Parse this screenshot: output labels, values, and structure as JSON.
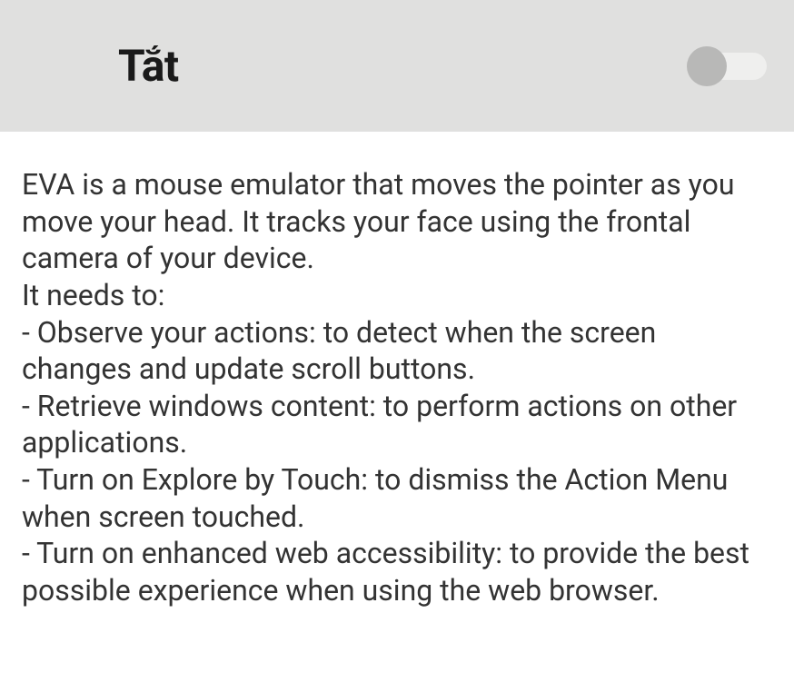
{
  "header": {
    "title": "Tắt",
    "toggle_state": "off"
  },
  "content": {
    "description": "EVA is a mouse emulator that moves the pointer as you move your head. It tracks your face using the frontal camera of your device.\nIt needs to:\n- Observe your actions: to detect when the screen changes and update scroll buttons.\n- Retrieve windows content: to perform actions on other applications.\n- Turn on Explore by Touch: to dismiss the Action Menu when screen touched.\n- Turn on enhanced web accessibility: to provide the best possible experience when using the web browser."
  }
}
